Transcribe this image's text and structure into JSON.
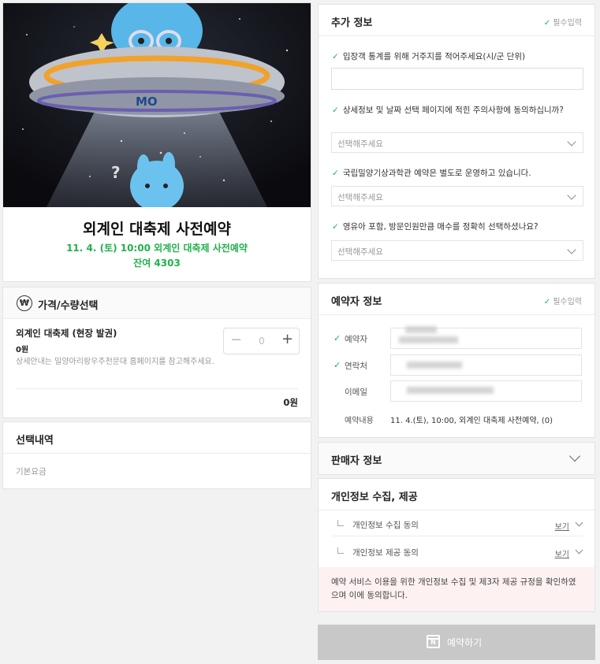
{
  "event": {
    "title": "외계인 대축제 사전예약",
    "subtitle": "11. 4. (토) 10:00 외계인 대축제 사전예약",
    "remaining": "잔여 4303"
  },
  "price_section": {
    "icon": "won-icon",
    "icon_glyph": "₩",
    "title": "가격/수량선택",
    "ticket_name": "외계인 대축제 (현장 발권)",
    "ticket_price": "0원",
    "ticket_note": "상세안내는 밀양아리랑우주천문대 홈페이지를 참고해주세요.",
    "stepper": {
      "minus": "−",
      "quantity": "0",
      "plus": "+"
    },
    "total": "0원"
  },
  "selection": {
    "title": "선택내역",
    "base_fee": "기본요금"
  },
  "extra_info": {
    "title": "추가 정보",
    "required": "필수입력",
    "questions": [
      {
        "label": "입장객 통계를 위해 거주지를 적어주세요(시/군 단위)",
        "type": "text",
        "value": ""
      },
      {
        "label": "상세정보 및 날짜 선택 페이지에 적힌 주의사항에 동의하십니까?",
        "type": "select",
        "placeholder": "선택해주세요"
      },
      {
        "label": "국립밀양기상과학관 예약은 별도로 운영하고 있습니다.",
        "type": "select",
        "placeholder": "선택해주세요"
      },
      {
        "label": "영유아 포함, 방문인원만큼 매수를 정확히 선택하셨나요?",
        "type": "select",
        "placeholder": "선택해주세요"
      }
    ]
  },
  "booker": {
    "title": "예약자 정보",
    "required": "필수입력",
    "fields": [
      {
        "label": "예약자",
        "checked": true
      },
      {
        "label": "연락처",
        "checked": true
      },
      {
        "label": "이메일",
        "checked": false
      }
    ],
    "content_label": "예약내용",
    "content_value": "11. 4.(토), 10:00, 외계인 대축제 사전예약, (0)"
  },
  "seller": {
    "title": "판매자 정보"
  },
  "privacy": {
    "title": "개인정보 수집, 제공",
    "items": [
      {
        "label": "개인정보 수집 동의",
        "view": "보기"
      },
      {
        "label": "개인정보 제공 동의",
        "view": "보기"
      }
    ],
    "agreement": "예약 서비스 이용을 위한 개인정보 수집 및 제3자 제공 규정을 확인하였으며 이에 동의합니다."
  },
  "reserve_button": {
    "label": "예약하기",
    "icon": "naver-calendar-icon",
    "icon_glyph": "N"
  },
  "colors": {
    "accent_green": "#22b14c",
    "disabled_button": "#c8c8c8",
    "agree_bg": "#fdf1f1"
  }
}
